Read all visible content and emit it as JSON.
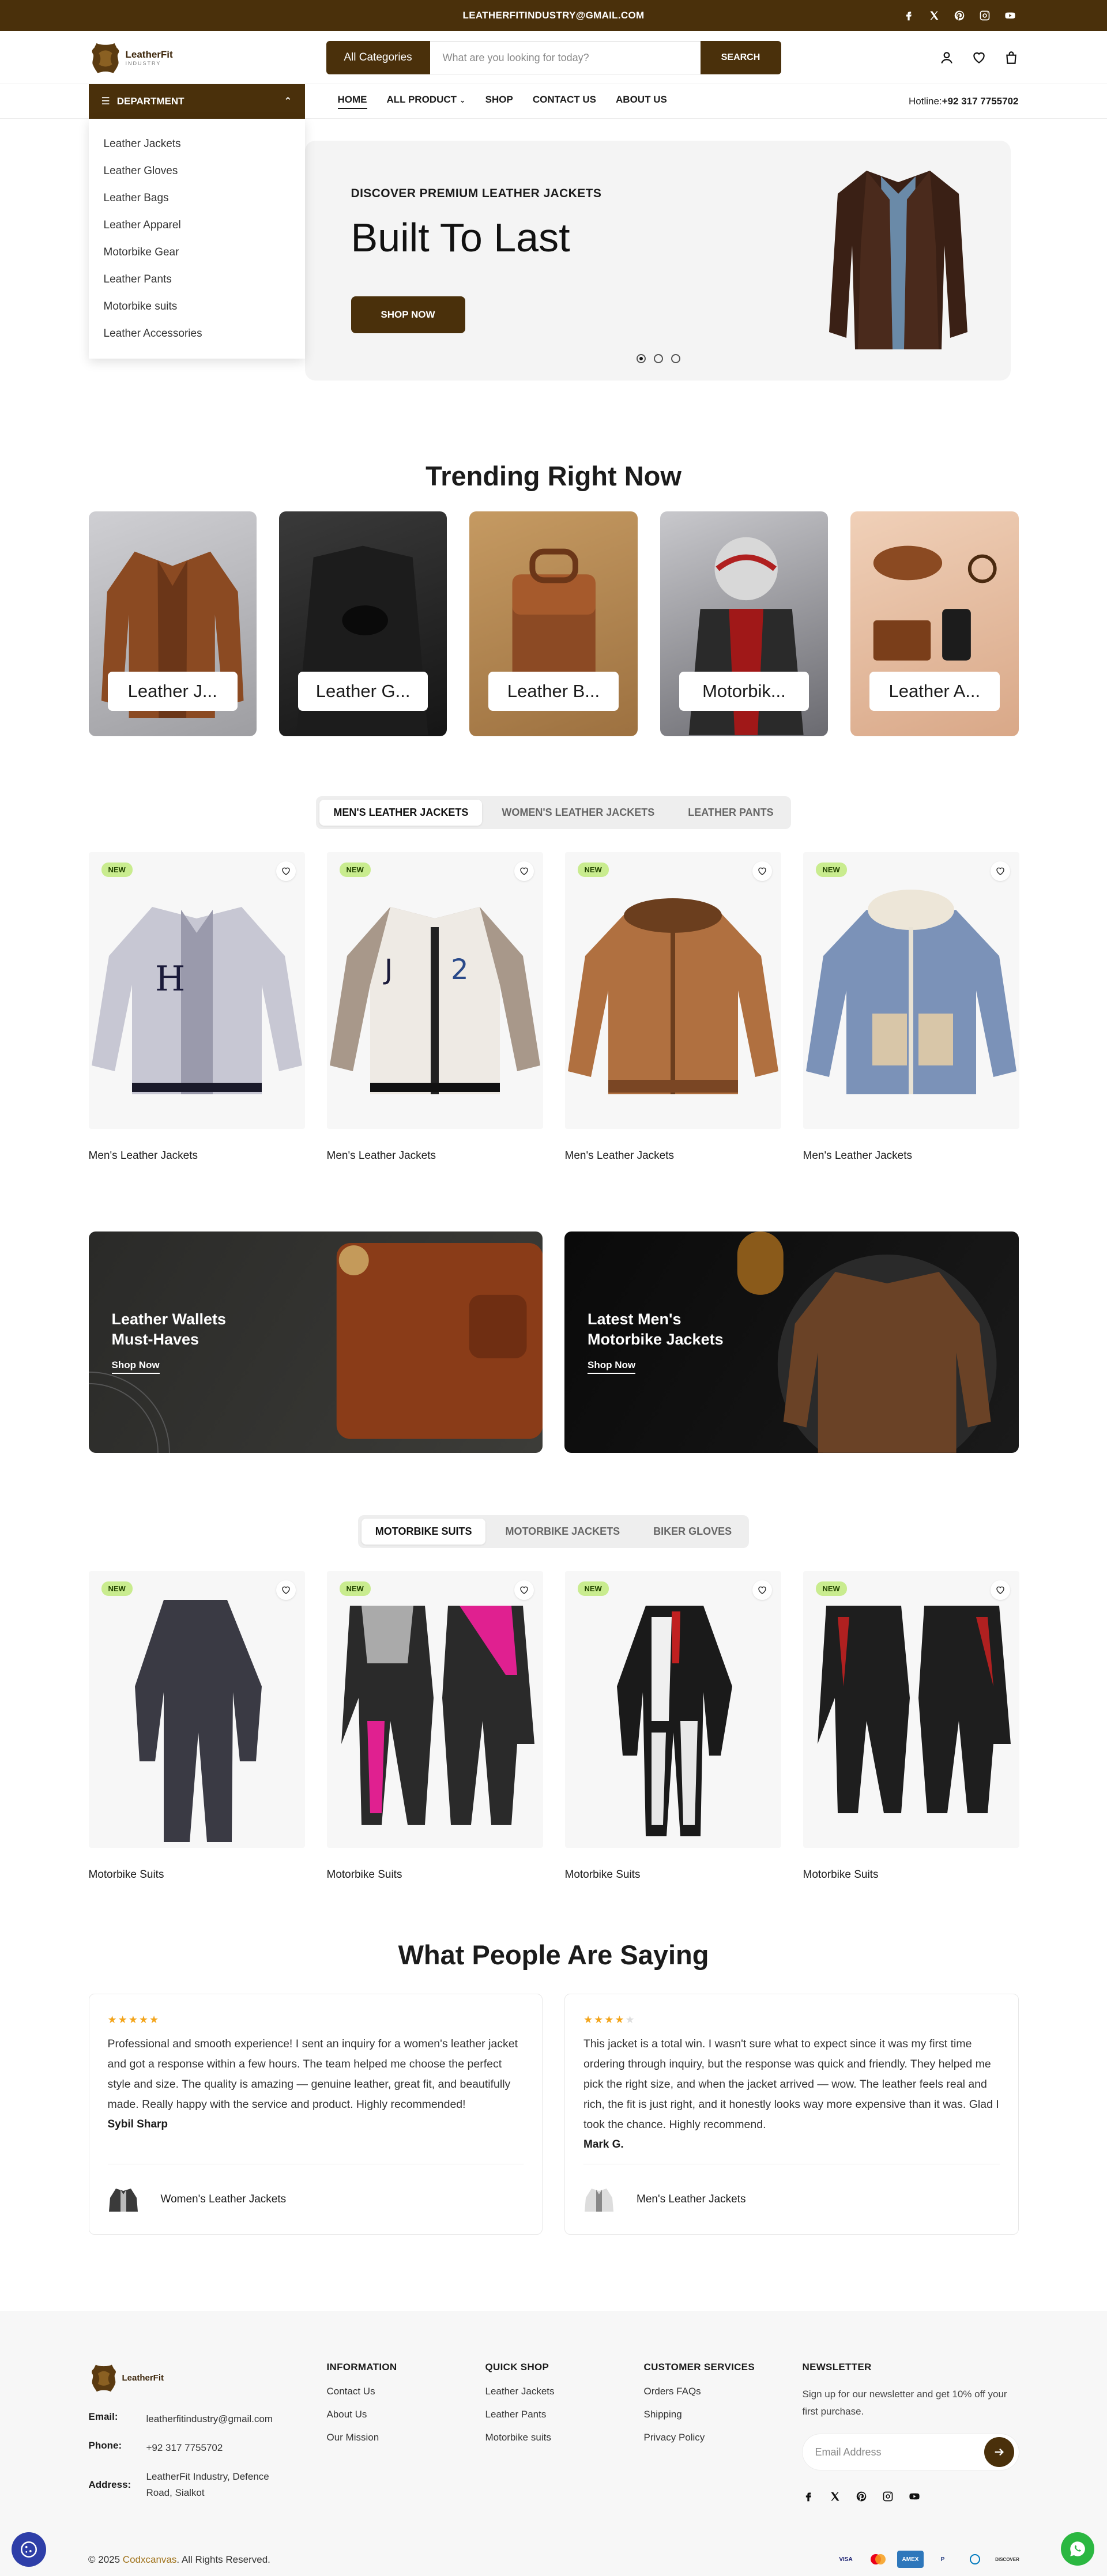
{
  "topbar": {
    "email": "LEATHERFITINDUSTRY@GMAIL.COM",
    "social_icons": [
      "facebook-icon",
      "x-icon",
      "pinterest-icon",
      "instagram-icon",
      "youtube-icon"
    ]
  },
  "header": {
    "logo_name": "LeatherFit",
    "logo_sub": "industry",
    "category_label": "All Categories",
    "search_placeholder": "What are you looking for today?",
    "search_button": "SEARCH"
  },
  "nav": {
    "department_label": "DEPARTMENT",
    "items": [
      "HOME",
      "ALL PRODUCT",
      "SHOP",
      "CONTACT US",
      "ABOUT US"
    ],
    "hotline_label": "Hotline:",
    "hotline_value": "+92 317 7755702"
  },
  "departments": [
    "Leather Jackets",
    "Leather Gloves",
    "Leather Bags",
    "Leather Apparel",
    "Motorbike Gear",
    "Leather Pants",
    "Motorbike suits",
    "Leather Accessories"
  ],
  "hero": {
    "kicker": "DISCOVER PREMIUM LEATHER JACKETS",
    "title": "Built To Last",
    "button": "SHOP NOW",
    "slide_count": 3,
    "active_slide": 1
  },
  "trending": {
    "title": "Trending Right Now",
    "items": [
      "Leather J...",
      "Leather G...",
      "Leather B...",
      "Motorbik...",
      "Leather A..."
    ]
  },
  "tabs1": {
    "items": [
      "MEN'S LEATHER JACKETS",
      "WOMEN'S LEATHER JACKETS",
      "LEATHER PANTS"
    ],
    "active": 0
  },
  "products1": [
    {
      "badge": "NEW",
      "name": "Men's Leather Jackets"
    },
    {
      "badge": "NEW",
      "name": "Men's Leather Jackets"
    },
    {
      "badge": "NEW",
      "name": "Men's Leather Jackets"
    },
    {
      "badge": "NEW",
      "name": "Men's Leather Jackets"
    }
  ],
  "banners": [
    {
      "title_1": "Leather Wallets",
      "title_2": "Must-Haves",
      "link": "Shop Now"
    },
    {
      "title_1": "Latest Men's",
      "title_2": "Motorbike Jackets",
      "link": "Shop Now"
    }
  ],
  "tabs2": {
    "items": [
      "MOTORBIKE SUITS",
      "MOTORBIKE JACKETS",
      "BIKER GLOVES"
    ],
    "active": 0
  },
  "products2": [
    {
      "badge": "NEW",
      "name": "Motorbike Suits"
    },
    {
      "badge": "NEW",
      "name": "Motorbike Suits"
    },
    {
      "badge": "NEW",
      "name": "Motorbike Suits"
    },
    {
      "badge": "NEW",
      "name": "Motorbike Suits"
    }
  ],
  "reviews": {
    "title": "What People Are Saying",
    "items": [
      {
        "rating": 5,
        "text": "Professional and smooth experience! I sent an inquiry for a women's leather jacket and got a response within a few hours. The team helped me choose the perfect style and size. The quality is amazing — genuine leather, great fit, and beautifully made. Really happy with the service and product. Highly recommended!",
        "author": "Sybil Sharp",
        "product": "Women's Leather Jackets"
      },
      {
        "rating": 4,
        "text": "This jacket is a total win. I wasn't sure what to expect since it was my first time ordering through inquiry, but the response was quick and friendly. They helped me pick the right size, and when the jacket arrived — wow. The leather feels real and rich, the fit is just right, and it honestly looks way more expensive than it was. Glad I took the chance. Highly recommend.",
        "author": "Mark G.",
        "product": "Men's Leather Jackets"
      }
    ]
  },
  "footer": {
    "logo_name": "LeatherFit",
    "email_label": "Email:",
    "email": "leatherfitindustry@gmail.com",
    "phone_label": "Phone:",
    "phone": "+92 317 7755702",
    "address_label": "Address:",
    "address_1": "LeatherFit Industry, Defence",
    "address_2": "Road, Sialkot",
    "columns": [
      {
        "title": "INFORMATION",
        "links": [
          "Contact Us",
          "About Us",
          "Our Mission"
        ]
      },
      {
        "title": "QUICK SHOP",
        "links": [
          "Leather Jackets",
          "Leather Pants",
          "Motorbike suits"
        ]
      },
      {
        "title": "CUSTOMER SERVICES",
        "links": [
          "Orders FAQs",
          "Shipping",
          "Privacy Policy"
        ]
      }
    ],
    "newsletter_title": "NEWSLETTER",
    "newsletter_text": "Sign up for our newsletter and get 10% off your first purchase.",
    "newsletter_placeholder": "Email Address",
    "copyright_prefix": "© 2025 ",
    "copyright_brand": "Codxcanvas",
    "copyright_suffix": ". All Rights Reserved.",
    "payments": [
      "VISA",
      "mastercard",
      "AMEX",
      "PayPal",
      "Diners",
      "DISCOVER"
    ]
  },
  "colors": {
    "brand": "#4a300b",
    "badge_new": "#c9ec8f",
    "star": "#f3a41a",
    "whatsapp": "#2bb741"
  }
}
